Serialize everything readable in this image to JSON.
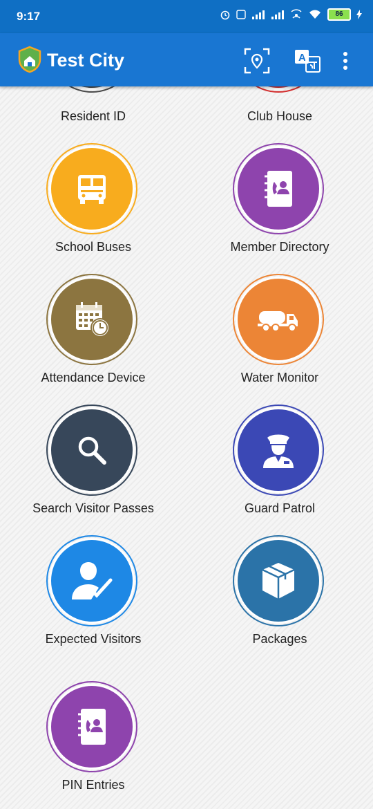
{
  "status": {
    "time": "9:17",
    "battery": "86"
  },
  "appbar": {
    "title": "Test City"
  },
  "tiles": [
    {
      "label": "Resident ID",
      "color": "#4a4a4a"
    },
    {
      "label": "Club House",
      "color": "#d32f2f"
    },
    {
      "label": "School Buses",
      "color": "#f8ac1e",
      "icon": "school-bus-icon"
    },
    {
      "label": "Member Directory",
      "color": "#8e44ad",
      "icon": "contact-book-icon"
    },
    {
      "label": "Attendance Device",
      "color": "#8c7540",
      "icon": "calendar-clock-icon"
    },
    {
      "label": "Water Monitor",
      "color": "#ec8536",
      "icon": "water-tanker-icon"
    },
    {
      "label": "Search Visitor Passes",
      "color": "#37475a",
      "icon": "search-icon"
    },
    {
      "label": "Guard Patrol",
      "color": "#3b48b5",
      "icon": "guard-icon"
    },
    {
      "label": "Expected Visitors",
      "color": "#1e88e5",
      "icon": "visitor-check-icon"
    },
    {
      "label": "Packages",
      "color": "#2b73a8",
      "icon": "package-icon"
    },
    {
      "label": "PIN Entries",
      "color": "#8e44ad",
      "icon": "contact-book-icon"
    }
  ]
}
